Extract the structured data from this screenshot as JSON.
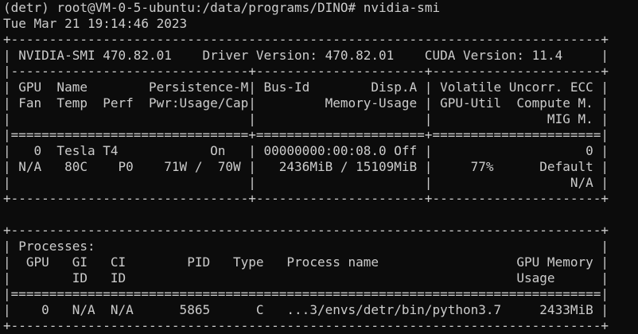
{
  "terminal": {
    "prompt": "(detr) root@VM-0-5-ubuntu:/data/programs/DINO# ",
    "command": "nvidia-smi",
    "timestamp": "Tue Mar 21 19:14:46 2023",
    "output_lines": [
      "+-----------------------------------------------------------------------------+",
      "| NVIDIA-SMI 470.82.01    Driver Version: 470.82.01    CUDA Version: 11.4     |",
      "|-------------------------------+----------------------+----------------------+",
      "| GPU  Name        Persistence-M| Bus-Id        Disp.A | Volatile Uncorr. ECC |",
      "| Fan  Temp  Perf  Pwr:Usage/Cap|         Memory-Usage | GPU-Util  Compute M. |",
      "|                               |                      |               MIG M. |",
      "|===============================+======================+======================|",
      "|   0  Tesla T4            On   | 00000000:00:08.0 Off |                    0 |",
      "| N/A   80C    P0    71W /  70W |   2436MiB / 15109MiB |     77%      Default |",
      "|                               |                      |                  N/A |",
      "+-------------------------------+----------------------+----------------------+",
      "",
      "+-----------------------------------------------------------------------------+",
      "| Processes:                                                                  |",
      "|  GPU   GI   CI        PID   Type   Process name                  GPU Memory |",
      "|        ID   ID                                                   Usage      |",
      "|=============================================================================|",
      "|    0   N/A  N/A      5865      C   ...3/envs/detr/bin/python3.7     2433MiB |",
      "+-----------------------------------------------------------------------------+"
    ]
  },
  "colors": {
    "background": "#0c0c0c",
    "foreground": "#cccccc"
  }
}
